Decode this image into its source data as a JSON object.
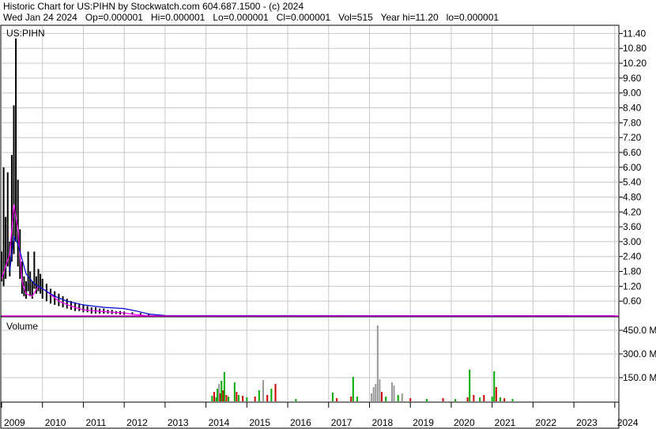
{
  "header": {
    "line1": "Historic Chart for US:PIHN by Stockwatch.com 604.687.1500 - (c) 2024",
    "line2": "Wed Jan 24 2024   Op=0.000001   Hi=0.000001   Lo=0.000001   Cl=0.000001   Vol=515   Year hi=11.20   lo=0.000001"
  },
  "chart_data": {
    "type": "bar",
    "symbol_label": "US:PIHN",
    "volume_label": "Volume",
    "colors": {
      "price": "#000000",
      "ma_short": "#ff00ff",
      "ma_long": "#0000cc",
      "volume_up": "#00aa00",
      "volume_down": "#cc0000",
      "volume_flat": "#999999",
      "grid": "#c8c8c8"
    },
    "x_axis": {
      "labels": [
        "2009",
        "2010",
        "2011",
        "2012",
        "2013",
        "2014",
        "2015",
        "2016",
        "2017",
        "2018",
        "2019",
        "2020",
        "2021",
        "2022",
        "2023",
        "2024"
      ],
      "range": [
        2009.0,
        2024.1
      ]
    },
    "price_axis": {
      "ticks": [
        "11.40",
        "10.80",
        "10.20",
        "9.60",
        "9.00",
        "8.40",
        "7.80",
        "7.20",
        "6.60",
        "6.00",
        "5.40",
        "4.80",
        "4.20",
        "3.60",
        "3.00",
        "2.40",
        "1.80",
        "1.20",
        "0.60"
      ],
      "range": [
        0,
        11.7
      ]
    },
    "volume_axis": {
      "ticks": [
        "450.0 M",
        "300.0 M",
        "150.0 M"
      ],
      "range": [
        0,
        530
      ]
    },
    "price_series": [
      {
        "x": 2009.0,
        "high": 2.6,
        "low": 1.4
      },
      {
        "x": 2009.05,
        "high": 6.0,
        "low": 1.2
      },
      {
        "x": 2009.1,
        "high": 4.0,
        "low": 1.5
      },
      {
        "x": 2009.15,
        "high": 5.8,
        "low": 2.0
      },
      {
        "x": 2009.2,
        "high": 3.0,
        "low": 1.6
      },
      {
        "x": 2009.25,
        "high": 6.5,
        "low": 2.2
      },
      {
        "x": 2009.3,
        "high": 8.5,
        "low": 2.5
      },
      {
        "x": 2009.35,
        "high": 11.2,
        "low": 3.0
      },
      {
        "x": 2009.4,
        "high": 5.5,
        "low": 2.0
      },
      {
        "x": 2009.45,
        "high": 3.5,
        "low": 1.5
      },
      {
        "x": 2009.5,
        "high": 2.2,
        "low": 0.9
      },
      {
        "x": 2009.55,
        "high": 1.6,
        "low": 0.8
      },
      {
        "x": 2009.6,
        "high": 1.4,
        "low": 0.7
      },
      {
        "x": 2009.65,
        "high": 2.6,
        "low": 1.0
      },
      {
        "x": 2009.7,
        "high": 1.8,
        "low": 0.8
      },
      {
        "x": 2009.75,
        "high": 1.4,
        "low": 0.7
      },
      {
        "x": 2009.8,
        "high": 2.6,
        "low": 1.1
      },
      {
        "x": 2009.85,
        "high": 1.6,
        "low": 0.9
      },
      {
        "x": 2009.9,
        "high": 1.9,
        "low": 1.0
      },
      {
        "x": 2009.95,
        "high": 1.7,
        "low": 0.9
      },
      {
        "x": 2010.0,
        "high": 1.5,
        "low": 0.7
      },
      {
        "x": 2010.1,
        "high": 1.3,
        "low": 0.6
      },
      {
        "x": 2010.2,
        "high": 1.1,
        "low": 0.5
      },
      {
        "x": 2010.3,
        "high": 1.0,
        "low": 0.45
      },
      {
        "x": 2010.4,
        "high": 0.9,
        "low": 0.4
      },
      {
        "x": 2010.5,
        "high": 0.8,
        "low": 0.35
      },
      {
        "x": 2010.6,
        "high": 0.7,
        "low": 0.3
      },
      {
        "x": 2010.7,
        "high": 0.6,
        "low": 0.25
      },
      {
        "x": 2010.8,
        "high": 0.55,
        "low": 0.2
      },
      {
        "x": 2010.9,
        "high": 0.5,
        "low": 0.2
      },
      {
        "x": 2011.0,
        "high": 0.45,
        "low": 0.15
      },
      {
        "x": 2011.1,
        "high": 0.4,
        "low": 0.15
      },
      {
        "x": 2011.2,
        "high": 0.35,
        "low": 0.1
      },
      {
        "x": 2011.3,
        "high": 0.35,
        "low": 0.1
      },
      {
        "x": 2011.4,
        "high": 0.3,
        "low": 0.1
      },
      {
        "x": 2011.5,
        "high": 0.3,
        "low": 0.1
      },
      {
        "x": 2011.6,
        "high": 0.25,
        "low": 0.1
      },
      {
        "x": 2011.7,
        "high": 0.25,
        "low": 0.08
      },
      {
        "x": 2011.8,
        "high": 0.2,
        "low": 0.08
      },
      {
        "x": 2011.9,
        "high": 0.2,
        "low": 0.06
      },
      {
        "x": 2012.0,
        "high": 0.18,
        "low": 0.05
      },
      {
        "x": 2012.2,
        "high": 0.15,
        "low": 0.05
      },
      {
        "x": 2012.4,
        "high": 0.12,
        "low": 0.04
      },
      {
        "x": 2012.6,
        "high": 0.1,
        "low": 0.03
      },
      {
        "x": 2012.8,
        "high": 0.06,
        "low": 0.02
      },
      {
        "x": 2013.0,
        "high": 0.03,
        "low": 0.01
      }
    ],
    "ma_short": [
      [
        2009.0,
        1.5
      ],
      [
        2009.2,
        2.5
      ],
      [
        2009.3,
        4.5
      ],
      [
        2009.4,
        3.5
      ],
      [
        2009.5,
        1.4
      ],
      [
        2009.6,
        0.9
      ],
      [
        2009.75,
        0.8
      ],
      [
        2009.9,
        1.2
      ],
      [
        2010.1,
        1.0
      ],
      [
        2010.4,
        0.6
      ],
      [
        2010.7,
        0.4
      ],
      [
        2011.0,
        0.25
      ],
      [
        2011.5,
        0.18
      ],
      [
        2012.0,
        0.12
      ],
      [
        2012.3,
        0.05
      ],
      [
        2012.6,
        0.01
      ],
      [
        2024.0,
        0.01
      ]
    ],
    "ma_long": [
      [
        2009.2,
        1.8
      ],
      [
        2009.3,
        3.2
      ],
      [
        2009.4,
        2.9
      ],
      [
        2009.6,
        1.7
      ],
      [
        2009.8,
        1.3
      ],
      [
        2010.0,
        1.1
      ],
      [
        2010.3,
        0.8
      ],
      [
        2010.6,
        0.6
      ],
      [
        2011.0,
        0.45
      ],
      [
        2011.5,
        0.35
      ],
      [
        2012.0,
        0.3
      ],
      [
        2012.3,
        0.2
      ],
      [
        2012.6,
        0.08
      ],
      [
        2013.0,
        0.02
      ],
      [
        2024.0,
        0.01
      ]
    ],
    "volume_series": [
      {
        "x": 2014.15,
        "value": 35,
        "color": "up"
      },
      {
        "x": 2014.2,
        "value": 60,
        "color": "down"
      },
      {
        "x": 2014.25,
        "value": 25,
        "color": "up"
      },
      {
        "x": 2014.28,
        "value": 80,
        "color": "up"
      },
      {
        "x": 2014.32,
        "value": 110,
        "color": "flat"
      },
      {
        "x": 2014.35,
        "value": 50,
        "color": "down"
      },
      {
        "x": 2014.38,
        "value": 130,
        "color": "up"
      },
      {
        "x": 2014.42,
        "value": 70,
        "color": "down"
      },
      {
        "x": 2014.45,
        "value": 185,
        "color": "up"
      },
      {
        "x": 2014.5,
        "value": 40,
        "color": "down"
      },
      {
        "x": 2014.55,
        "value": 30,
        "color": "up"
      },
      {
        "x": 2014.7,
        "value": 120,
        "color": "up"
      },
      {
        "x": 2014.75,
        "value": 60,
        "color": "down"
      },
      {
        "x": 2014.8,
        "value": 40,
        "color": "up"
      },
      {
        "x": 2014.9,
        "value": 35,
        "color": "down"
      },
      {
        "x": 2015.0,
        "value": 25,
        "color": "up"
      },
      {
        "x": 2015.2,
        "value": 30,
        "color": "down"
      },
      {
        "x": 2015.3,
        "value": 70,
        "color": "up"
      },
      {
        "x": 2015.4,
        "value": 135,
        "color": "flat"
      },
      {
        "x": 2015.5,
        "value": 40,
        "color": "down"
      },
      {
        "x": 2015.6,
        "value": 80,
        "color": "up"
      },
      {
        "x": 2015.7,
        "value": 110,
        "color": "down"
      },
      {
        "x": 2016.2,
        "value": 15,
        "color": "up"
      },
      {
        "x": 2017.1,
        "value": 55,
        "color": "up"
      },
      {
        "x": 2017.2,
        "value": 20,
        "color": "down"
      },
      {
        "x": 2017.55,
        "value": 30,
        "color": "down"
      },
      {
        "x": 2017.6,
        "value": 155,
        "color": "up"
      },
      {
        "x": 2017.7,
        "value": 30,
        "color": "up"
      },
      {
        "x": 2018.05,
        "value": 50,
        "color": "flat"
      },
      {
        "x": 2018.1,
        "value": 90,
        "color": "flat"
      },
      {
        "x": 2018.15,
        "value": 110,
        "color": "flat"
      },
      {
        "x": 2018.2,
        "value": 480,
        "color": "flat"
      },
      {
        "x": 2018.25,
        "value": 140,
        "color": "flat"
      },
      {
        "x": 2018.3,
        "value": 60,
        "color": "down"
      },
      {
        "x": 2018.4,
        "value": 30,
        "color": "up"
      },
      {
        "x": 2018.55,
        "value": 120,
        "color": "flat"
      },
      {
        "x": 2018.6,
        "value": 100,
        "color": "flat"
      },
      {
        "x": 2018.7,
        "value": 40,
        "color": "up"
      },
      {
        "x": 2018.8,
        "value": 50,
        "color": "flat"
      },
      {
        "x": 2019.0,
        "value": 20,
        "color": "down"
      },
      {
        "x": 2019.4,
        "value": 15,
        "color": "up"
      },
      {
        "x": 2019.8,
        "value": 20,
        "color": "down"
      },
      {
        "x": 2020.1,
        "value": 15,
        "color": "up"
      },
      {
        "x": 2020.4,
        "value": 25,
        "color": "down"
      },
      {
        "x": 2020.45,
        "value": 200,
        "color": "up"
      },
      {
        "x": 2020.55,
        "value": 40,
        "color": "down"
      },
      {
        "x": 2020.7,
        "value": 25,
        "color": "up"
      },
      {
        "x": 2020.8,
        "value": 40,
        "color": "down"
      },
      {
        "x": 2021.0,
        "value": 30,
        "color": "up"
      },
      {
        "x": 2021.05,
        "value": 190,
        "color": "up"
      },
      {
        "x": 2021.1,
        "value": 90,
        "color": "down"
      },
      {
        "x": 2021.2,
        "value": 25,
        "color": "up"
      },
      {
        "x": 2021.3,
        "value": 20,
        "color": "down"
      },
      {
        "x": 2021.5,
        "value": 15,
        "color": "up"
      }
    ]
  }
}
